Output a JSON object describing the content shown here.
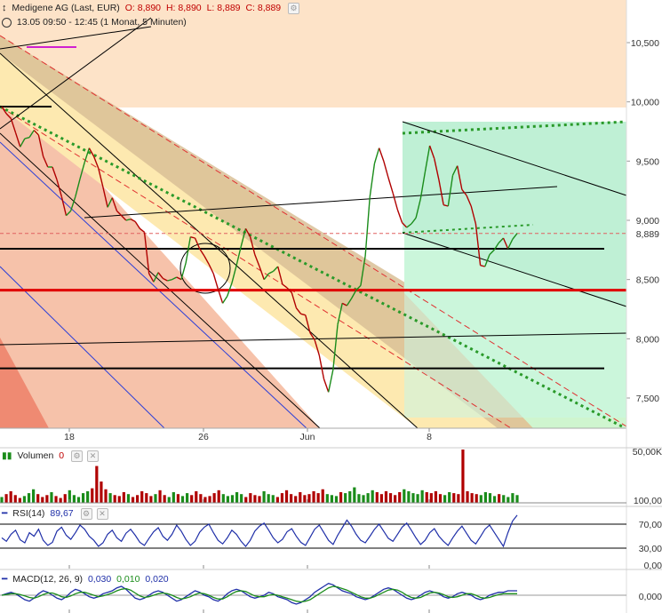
{
  "header": {
    "title": "Medigene AG (Last, EUR)",
    "open": "O: 8,890",
    "high": "H: 8,890",
    "low": "L: 8,889",
    "close": "C: 8,889",
    "range": "13.05 09:50 - 12:45 (1 Monat, 5 Minuten)"
  },
  "chart_data": [
    {
      "type": "line",
      "title": "Medigene AG (Last, EUR)",
      "price_axis_ticks": [
        "10,500",
        "10,000",
        "9,500",
        "9,000",
        "8,500",
        "8,000",
        "7,500"
      ],
      "current_price_label": "8,889",
      "ylim": [
        7.3,
        10.9
      ],
      "x_tick_labels": [
        "18",
        "26",
        "Jun",
        "8"
      ],
      "series": [
        {
          "values": [
            9.96,
            9.9,
            9.86,
            9.74,
            9.62,
            9.69,
            9.7,
            9.76,
            9.72,
            9.54,
            9.45,
            9.45,
            9.34,
            9.2,
            9.04,
            9.08,
            9.2,
            9.35,
            9.49,
            9.61,
            9.54,
            9.44,
            9.28,
            9.11,
            9.19,
            9.08,
            9.04,
            9.0,
            9.01,
            8.99,
            8.93,
            8.9,
            8.55,
            8.48,
            8.56,
            8.51,
            8.49,
            8.5,
            8.52,
            8.5,
            8.64,
            8.86,
            8.85,
            8.76,
            8.7,
            8.63,
            8.55,
            8.42,
            8.3,
            8.36,
            8.47,
            8.62,
            8.78,
            8.93,
            8.86,
            8.71,
            8.61,
            8.5,
            8.55,
            8.57,
            8.61,
            8.46,
            8.43,
            8.39,
            8.26,
            8.21,
            8.2,
            8.05,
            7.99,
            7.86,
            7.66,
            7.55,
            7.74,
            8.12,
            8.3,
            8.28,
            8.34,
            8.41,
            8.45,
            8.7,
            9.2,
            9.48,
            9.61,
            9.5,
            9.36,
            9.23,
            9.09,
            8.98,
            8.94,
            8.97,
            9.02,
            9.18,
            9.41,
            9.63,
            9.52,
            9.34,
            9.13,
            9.12,
            9.38,
            9.46,
            9.26,
            9.21,
            9.12,
            8.97,
            8.62,
            8.61,
            8.71,
            8.75,
            8.81,
            8.85,
            8.76,
            8.84,
            8.89
          ]
        }
      ],
      "horizontal_lines": [
        {
          "value": 8.76,
          "color": "#000000"
        },
        {
          "value": 8.41,
          "color": "#e00000"
        },
        {
          "value": 7.75,
          "color": "#000000"
        },
        {
          "value": 8.889,
          "color": "#e06060",
          "style": "dashed"
        }
      ]
    },
    {
      "type": "bar",
      "title": "Volumen",
      "legend_value": "0",
      "axis_labels": [
        "50,00K",
        "100,00"
      ],
      "x_tick_labels": [
        "18",
        "26",
        "Jun",
        "8"
      ],
      "values": [
        6,
        9,
        12,
        8,
        5,
        7,
        10,
        14,
        9,
        6,
        8,
        11,
        7,
        5,
        9,
        13,
        8,
        6,
        10,
        12,
        15,
        38,
        22,
        14,
        10,
        8,
        7,
        11,
        9,
        6,
        8,
        12,
        10,
        7,
        9,
        13,
        8,
        6,
        11,
        9,
        7,
        10,
        8,
        12,
        9,
        6,
        7,
        10,
        13,
        9,
        7,
        8,
        11,
        9,
        6,
        10,
        8,
        7,
        12,
        9,
        8,
        6,
        10,
        13,
        9,
        7,
        11,
        8,
        9,
        12,
        10,
        14,
        9,
        8,
        7,
        11,
        10,
        12,
        16,
        9,
        8,
        10,
        13,
        11,
        9,
        12,
        10,
        8,
        11,
        14,
        12,
        10,
        9,
        13,
        11,
        10,
        12,
        9,
        8,
        11,
        10,
        9,
        55,
        12,
        10,
        9,
        8,
        11,
        10,
        7,
        9,
        8,
        6,
        10,
        8
      ]
    },
    {
      "type": "line",
      "title": "RSI(14)",
      "legend_value": "89,67",
      "axis_labels": [
        "100,00",
        "70,00",
        "30,00",
        "0,00"
      ],
      "x_tick_labels": [
        "18",
        "26",
        "Jun",
        "8"
      ],
      "ylim": [
        0,
        100
      ],
      "bands": [
        70,
        30
      ],
      "series": [
        {
          "name": "RSI(14)",
          "values": [
            45,
            38,
            52,
            60,
            41,
            35,
            55,
            48,
            62,
            40,
            30,
            36,
            58,
            66,
            50,
            42,
            55,
            70,
            62,
            48,
            40,
            28,
            35,
            52,
            60,
            45,
            38,
            54,
            62,
            50,
            36,
            30,
            44,
            57,
            65,
            48,
            40,
            52,
            70,
            58,
            42,
            30,
            38,
            56,
            66,
            72,
            55,
            40,
            33,
            45,
            60,
            52,
            38,
            28,
            40,
            58,
            68,
            74,
            60,
            45,
            35,
            42,
            57,
            63,
            48,
            36,
            30,
            46,
            62,
            70,
            55,
            40,
            32,
            50,
            65,
            80,
            68,
            52,
            40,
            35,
            48,
            62,
            72,
            58,
            44,
            38,
            52,
            66,
            74,
            60,
            45,
            32,
            40,
            55,
            63,
            48,
            38,
            30,
            45,
            58,
            68,
            54,
            40,
            33,
            47,
            62,
            70,
            56,
            42,
            28,
            55,
            78,
            89.67
          ]
        }
      ]
    },
    {
      "type": "line",
      "title": "MACD(12, 26, 9)",
      "legend_values": [
        "0,030",
        "0,010",
        "0,020"
      ],
      "axis_labels": [
        "0,000"
      ],
      "x_tick_labels": [
        "18",
        "26",
        "Jun",
        "8"
      ],
      "ylim": [
        -0.12,
        0.12
      ],
      "series": [
        {
          "name": "MACD(12, 26, 9)",
          "color": "#1f2fa8",
          "values": [
            0.0,
            0.01,
            0.02,
            0.01,
            -0.01,
            -0.03,
            -0.04,
            -0.02,
            0.01,
            0.03,
            0.02,
            0.0,
            -0.02,
            -0.03,
            -0.01,
            0.02,
            0.04,
            0.03,
            0.01,
            -0.01,
            -0.02,
            -0.01,
            0.01,
            0.02,
            0.03,
            0.05,
            0.06,
            0.04,
            0.01,
            -0.02,
            -0.03,
            -0.02,
            0.0,
            0.02,
            0.03,
            0.02,
            0.0,
            -0.02,
            -0.04,
            -0.03,
            -0.01,
            0.01,
            0.03,
            0.02,
            0.0,
            -0.01,
            -0.03,
            -0.04,
            -0.02,
            0.01,
            0.03,
            0.04,
            0.03,
            0.01,
            -0.01,
            -0.02,
            -0.01,
            0.0,
            0.02,
            0.01,
            -0.01,
            -0.02,
            -0.03,
            -0.05,
            -0.06,
            -0.05,
            -0.03,
            -0.01,
            0.02,
            0.04,
            0.06,
            0.08,
            0.07,
            0.05,
            0.03,
            0.02,
            0.01,
            -0.01,
            -0.02,
            -0.03,
            -0.02,
            0.0,
            0.02,
            0.04,
            0.05,
            0.04,
            0.02,
            0.0,
            -0.02,
            -0.03,
            -0.02,
            0.0,
            0.02,
            0.03,
            0.02,
            0.01,
            -0.01,
            -0.02,
            -0.01,
            0.01,
            0.02,
            0.01,
            0.0,
            -0.02,
            -0.03,
            -0.02,
            0.0,
            0.01,
            0.02,
            0.02,
            0.03,
            0.03,
            0.03
          ]
        },
        {
          "name": "signal",
          "color": "#1a8c1a",
          "values": [
            0.0,
            0.005,
            0.01,
            0.01,
            0.005,
            -0.005,
            -0.015,
            -0.02,
            -0.01,
            0.005,
            0.015,
            0.015,
            0.005,
            -0.01,
            -0.015,
            -0.005,
            0.01,
            0.02,
            0.02,
            0.01,
            0.0,
            -0.01,
            -0.005,
            0.005,
            0.015,
            0.03,
            0.04,
            0.045,
            0.035,
            0.015,
            -0.005,
            -0.015,
            -0.01,
            0.0,
            0.01,
            0.015,
            0.01,
            0.0,
            -0.015,
            -0.025,
            -0.02,
            -0.01,
            0.005,
            0.015,
            0.01,
            0.0,
            -0.015,
            -0.025,
            -0.025,
            -0.01,
            0.01,
            0.025,
            0.03,
            0.025,
            0.01,
            -0.005,
            -0.01,
            -0.01,
            0.0,
            0.005,
            0.0,
            -0.01,
            -0.02,
            -0.03,
            -0.04,
            -0.045,
            -0.04,
            -0.03,
            -0.01,
            0.01,
            0.03,
            0.05,
            0.06,
            0.055,
            0.045,
            0.035,
            0.02,
            0.005,
            -0.01,
            -0.02,
            -0.02,
            -0.01,
            0.005,
            0.02,
            0.035,
            0.04,
            0.035,
            0.02,
            0.0,
            -0.015,
            -0.02,
            -0.015,
            0.0,
            0.015,
            0.02,
            0.015,
            0.005,
            -0.01,
            -0.015,
            -0.01,
            0.0,
            0.01,
            0.01,
            0.0,
            -0.015,
            -0.02,
            -0.015,
            -0.005,
            0.005,
            0.01,
            0.01,
            0.01,
            0.01
          ]
        }
      ]
    }
  ],
  "colors": {
    "price_line": "#b00000",
    "price_line_up": "#1a8c1a",
    "support_red": "#e00000",
    "volume_up": "#1a8c1a",
    "volume_down": "#b00000",
    "rsi_line": "#1f2fa8",
    "macd_line": "#1f2fa8",
    "macd_signal": "#1a8c1a",
    "band_peach": "#fde3c8",
    "band_yellow": "#fde9b0",
    "band_brown": "#d9bf96",
    "band_salmon": "#f6c2aa",
    "band_green": "#cff5cf",
    "band_mint": "#c8f5e6"
  },
  "icons": [
    "chart-type-icon",
    "gear-icon",
    "clock-icon",
    "close-icon"
  ]
}
